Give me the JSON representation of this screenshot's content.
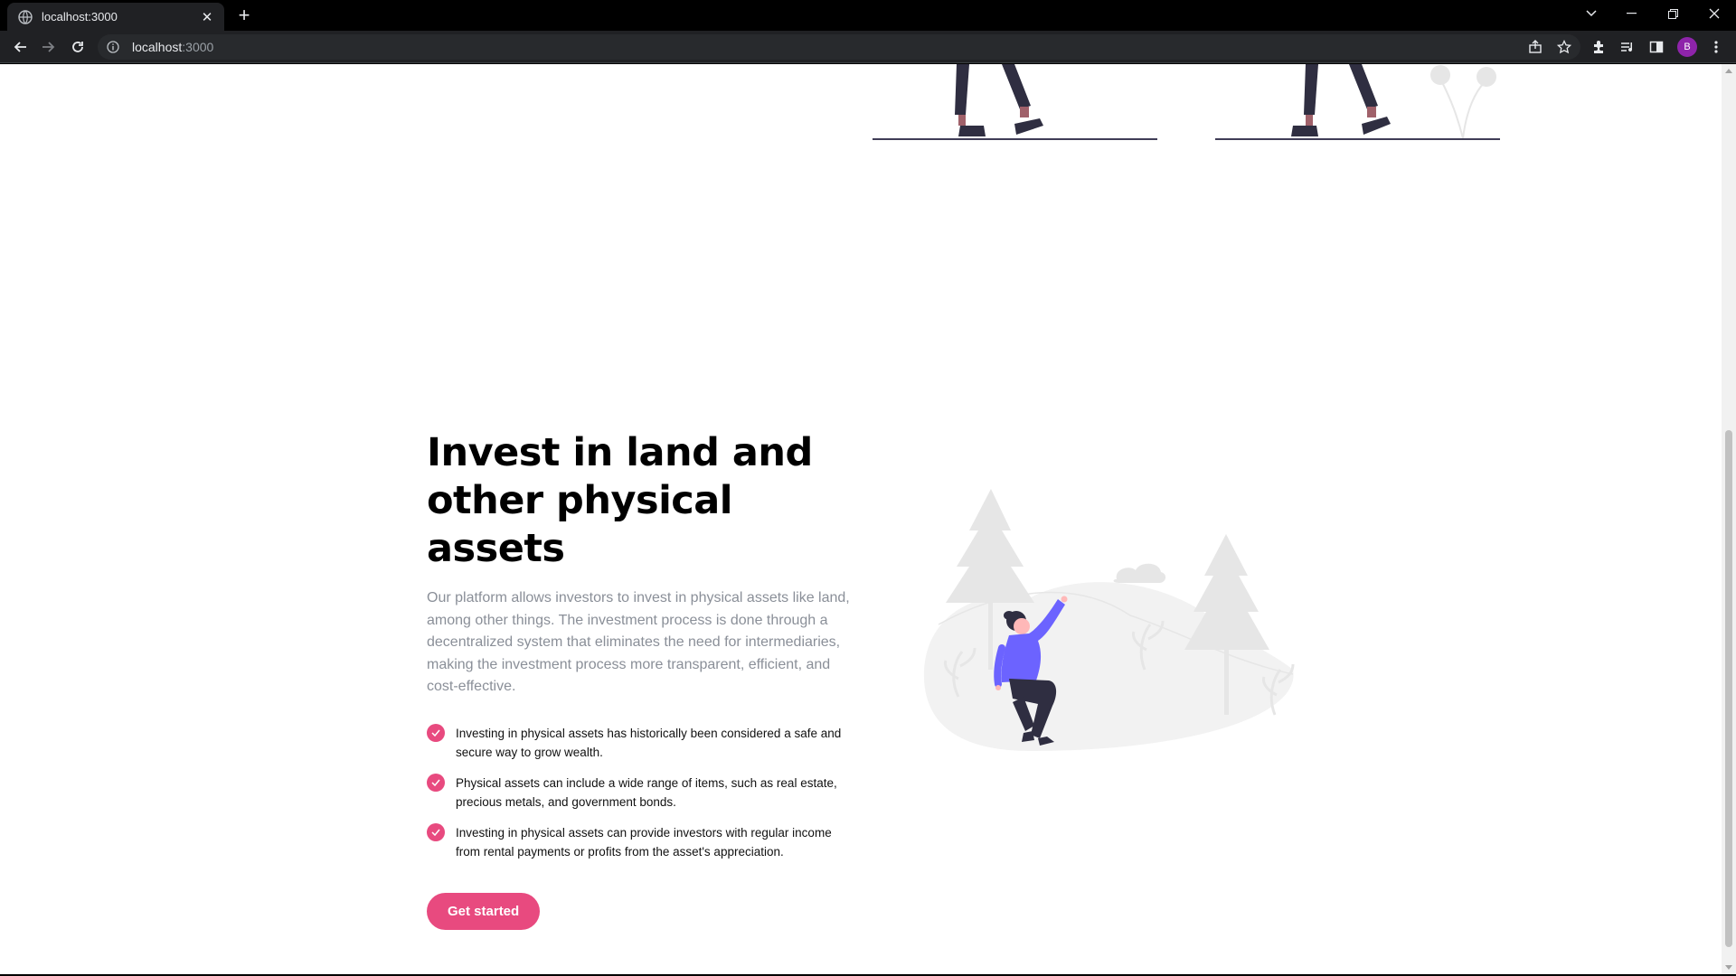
{
  "browser": {
    "tab_title": "localhost:3000",
    "url_host": "localhost",
    "url_port": ":3000",
    "profile_initial": "B"
  },
  "section": {
    "headline_line1": "Invest in land and",
    "headline_line2": "other physical assets",
    "description": "Our platform allows investors to invest in physical assets like land, among other things. The investment process is done through a decentralized system that eliminates the need for intermediaries, making the investment process more transparent, efficient, and cost-effective.",
    "features": [
      {
        "text": "Investing in physical assets has historically been considered a safe and secure way to grow wealth."
      },
      {
        "text": "Physical assets can include a wide range of items, such as real estate, precious metals, and government bonds."
      },
      {
        "text": "Investing in physical assets can provide investors with regular income from rental payments or profits from the asset's appreciation."
      }
    ],
    "cta_label": "Get started"
  },
  "colors": {
    "accent": "#e84a7f",
    "illustration_purple": "#6c63ff",
    "illustration_gray": "#e6e6e6",
    "figure_dark": "#2f2e41"
  },
  "scroll": {
    "thumb_position": 0.4,
    "thumb_size": 0.58
  }
}
